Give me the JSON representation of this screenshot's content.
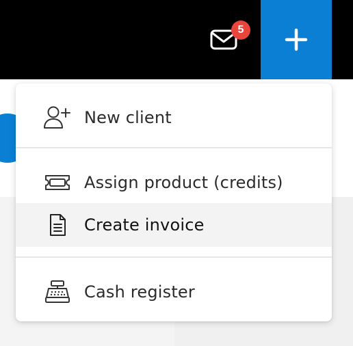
{
  "topbar": {
    "mail_badge_count": "5",
    "mail_icon": "envelope-icon",
    "plus_icon": "plus-icon",
    "accent_color": "#0a7fd4",
    "badge_color": "#e8453c"
  },
  "menu": {
    "items": [
      {
        "label": "New client",
        "icon": "user-plus-icon"
      },
      {
        "label": "Assign product (credits)",
        "icon": "ticket-icon"
      },
      {
        "label": "Create invoice",
        "icon": "document-icon",
        "highlighted": true
      },
      {
        "label": "Cash register",
        "icon": "cash-register-icon"
      }
    ]
  }
}
